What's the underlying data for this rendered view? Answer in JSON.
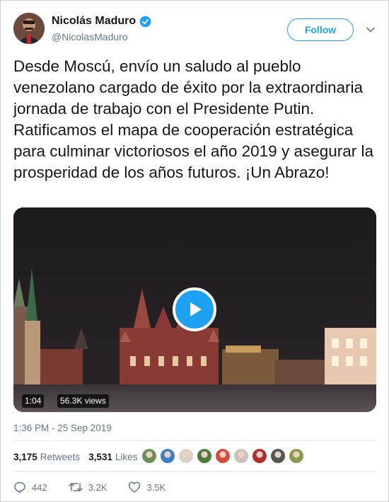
{
  "user": {
    "name": "Nicolás Maduro",
    "handle": "@NicolasMaduro",
    "verified": true
  },
  "follow_label": "Follow",
  "tweet_text": "Desde Moscú, envío un saludo al pueblo venezolano cargado de éxito por la extraordinaria jornada de trabajo con el Presidente Putin. Ratificamos el mapa de cooperación estratégica para culminar victoriosos el año 2019 y asegurar la prosperidad de los años futuros. ¡Un Abrazo!",
  "video": {
    "duration": "1:04",
    "views": "56.3K views"
  },
  "timestamp": "1:36 PM - 25 Sep 2019",
  "stats": {
    "retweets_count": "3,175",
    "retweets_label": "Retweets",
    "likes_count": "3,531",
    "likes_label": "Likes"
  },
  "likers": [
    {
      "color": "#6b8f5a"
    },
    {
      "color": "#3d7fc4"
    },
    {
      "color": "#d9d2cb"
    },
    {
      "color": "#4f7a3a"
    },
    {
      "color": "#d84a3a"
    },
    {
      "color": "#c9c2bb"
    },
    {
      "color": "#b03030"
    },
    {
      "color": "#555555"
    },
    {
      "color": "#8a9a4a"
    }
  ],
  "actions": {
    "replies": "442",
    "retweets": "3.2K",
    "likes": "3.5K"
  },
  "colors": {
    "accent": "#1da1f2",
    "muted": "#657786"
  }
}
